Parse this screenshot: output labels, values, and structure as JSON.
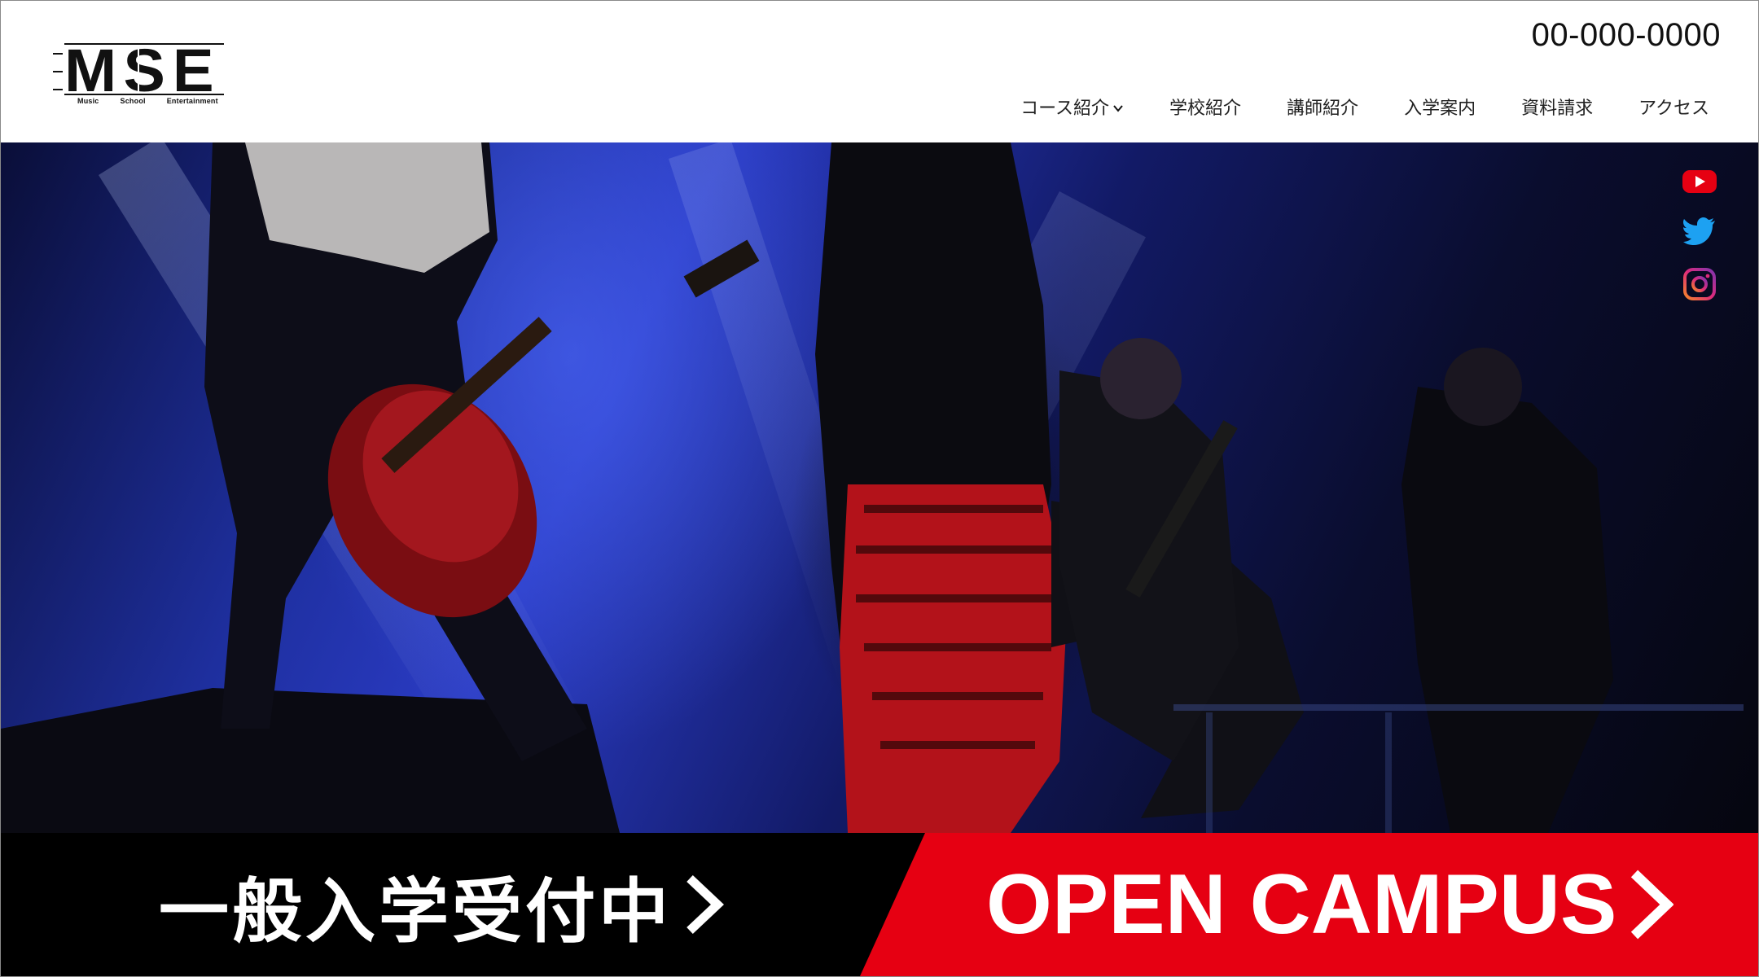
{
  "header": {
    "logo": {
      "letters": "MSE",
      "sub": [
        "Music",
        "School",
        "Entertainment"
      ]
    },
    "phone": "00-000-0000",
    "nav": [
      {
        "label": "コース紹介",
        "has_dropdown": true
      },
      {
        "label": "学校紹介"
      },
      {
        "label": "講師紹介"
      },
      {
        "label": "入学案内"
      },
      {
        "label": "資料請求"
      },
      {
        "label": "アクセス"
      }
    ]
  },
  "hero": {
    "social": [
      {
        "icon": "youtube-icon",
        "color": "#e60012"
      },
      {
        "icon": "twitter-icon",
        "color": "#1da1f2"
      },
      {
        "icon": "instagram-icon",
        "color": "#e1306c"
      }
    ]
  },
  "banners": {
    "left": {
      "label": "一般入学受付中",
      "bg": "#000000"
    },
    "right": {
      "label": "OPEN CAMPUS",
      "bg": "#e60012"
    }
  }
}
